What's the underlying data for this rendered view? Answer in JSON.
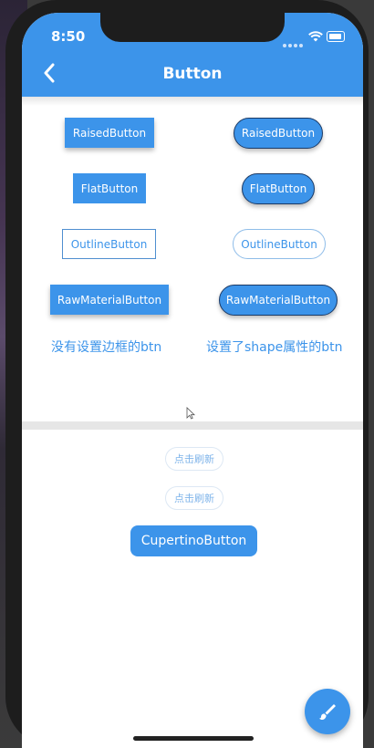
{
  "status_bar": {
    "time": "8:50"
  },
  "appbar": {
    "title": "Button",
    "back_icon": "back-arrow-icon"
  },
  "left_column": {
    "raised": "RaisedButton",
    "flat": "FlatButton",
    "outline": "OutlineButton",
    "raw": "RawMaterialButton",
    "caption": "没有设置边框的btn"
  },
  "right_column": {
    "raised": "RaisedButton",
    "flat": "FlatButton",
    "outline": "OutlineButton",
    "raw": "RawMaterialButton",
    "caption": "设置了shape属性的btn"
  },
  "lower": {
    "refresh_1": "点击刷新",
    "refresh_2": "点击刷新",
    "cupertino": "CupertinoButton"
  },
  "fab": {
    "icon": "brush-icon"
  },
  "colors": {
    "primary": "#3c94ea",
    "divider": "#e6e6e6"
  }
}
